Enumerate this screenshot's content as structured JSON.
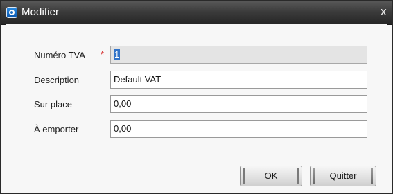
{
  "window": {
    "title": "Modifier",
    "icon": "app-logo-icon",
    "close_symbol": "x"
  },
  "form": {
    "vat_number": {
      "label": "Numéro TVA",
      "required_mark": "*",
      "value": "1"
    },
    "description": {
      "label": "Description",
      "value": "Default VAT"
    },
    "on_site": {
      "label": "Sur place",
      "value": "0,00"
    },
    "takeaway": {
      "label": "À emporter",
      "value": "0,00"
    }
  },
  "buttons": {
    "ok": "OK",
    "quit": "Quitter"
  },
  "colors": {
    "titlebar": "#2f2f2f",
    "required": "#d42020",
    "selection": "#3173c8"
  }
}
